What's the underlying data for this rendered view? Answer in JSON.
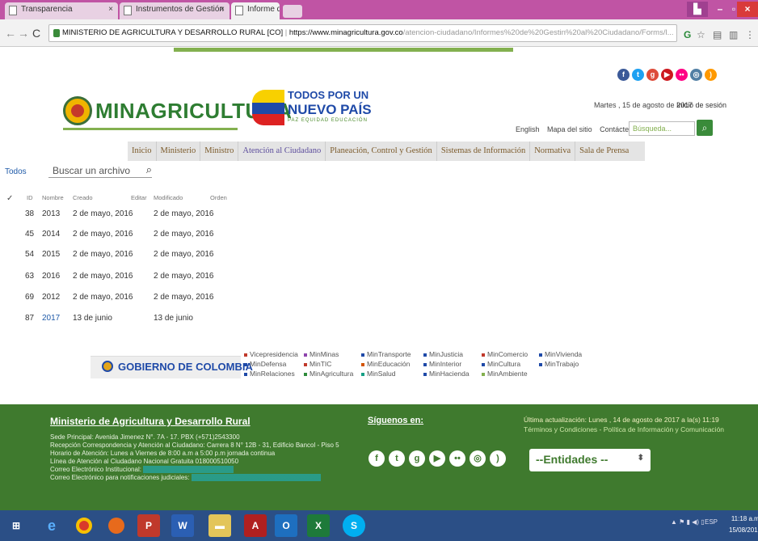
{
  "browser": {
    "tabs": [
      {
        "title": "Transparencia",
        "active": false
      },
      {
        "title": "Instrumentos de Gestión",
        "active": false
      },
      {
        "title": "Informe de Atención - T",
        "active": true
      }
    ],
    "url_site": "MINISTERIO DE AGRICULTURA Y DESARROLLO RURAL [CO]",
    "url_host": "https://www.minagricultura.gov.co",
    "url_path": "/atencion-ciudadano/Informes%20de%20Gestin%20al%20Ciudadano/Forms/l..."
  },
  "header": {
    "logo_text": "MINAGRICULTURA",
    "tpun_line1": "TODOS POR UN",
    "tpun_line2": "NUEVO PAÍS",
    "tpun_line3": "PAZ  EQUIDAD  EDUCACIÓN",
    "date": "Martes , 15 de agosto de 2017",
    "login": "Inicio de sesión",
    "links": [
      "English",
      "Mapa del sitio",
      "Contáctenos"
    ],
    "search_placeholder": "Búsqueda..."
  },
  "nav": [
    "Inicio",
    "Ministerio",
    "Ministro",
    "Atención al Ciudadano",
    "Planeación, Control y Gestión",
    "Sistemas de Información",
    "Normativa",
    "Sala de Prensa"
  ],
  "doclib": {
    "view_label": "Todos",
    "search_placeholder": "Buscar un archivo",
    "columns": [
      "ID",
      "Nombre",
      "Creado",
      "Editar",
      "Modificado",
      "Orden"
    ],
    "rows": [
      {
        "id": "38",
        "name": "2013",
        "created": "2 de mayo, 2016",
        "modified": "2 de mayo, 2016"
      },
      {
        "id": "45",
        "name": "2014",
        "created": "2 de mayo, 2016",
        "modified": "2 de mayo, 2016"
      },
      {
        "id": "54",
        "name": "2015",
        "created": "2 de mayo, 2016",
        "modified": "2 de mayo, 2016"
      },
      {
        "id": "63",
        "name": "2016",
        "created": "2 de mayo, 2016",
        "modified": "2 de mayo, 2016"
      },
      {
        "id": "69",
        "name": "2012",
        "created": "2 de mayo, 2016",
        "modified": "2 de mayo, 2016"
      },
      {
        "id": "87",
        "name": "2017",
        "created": "13 de junio",
        "modified": "13 de junio"
      }
    ]
  },
  "gobierno": {
    "label": "GOBIERNO DE COLOMBIA",
    "columns": [
      [
        "Vicepresidencia",
        "MinDefensa",
        "MinRelaciones"
      ],
      [
        "MinMinas",
        "MinTIC",
        "MinAgricultura"
      ],
      [
        "MinTransporte",
        "MinEducación",
        "MinSalud"
      ],
      [
        "MinJusticia",
        "MinInterior",
        "MinHacienda"
      ],
      [
        "MinComercio",
        "MinCultura",
        "MinAmbiente"
      ],
      [
        "MinVivienda",
        "MinTrabajo"
      ]
    ],
    "bullet_colors": [
      "#c0392b",
      "#1f4aa8",
      "#2e8b3a",
      "#8e44ad",
      "#d35400",
      "#16a085"
    ]
  },
  "footer": {
    "title": "Ministerio de Agricultura y Desarrollo Rural",
    "lines": [
      "Sede Principal: Avenida Jimenez N°. 7A - 17. PBX (+571)2543300",
      "Recepción Correspondencia y Atención al Ciudadano: Carrera 8 N° 12B - 31, Edificio Bancol - Piso 5",
      "Horario de Atención: Lunes a Viernes de 8:00 a.m a 5:00 p.m jornada continua",
      "Línea de Atención al Ciudadano Nacional Gratuita 018000510050"
    ],
    "email_inst_label": "Correo Electrónico Institucional:",
    "email_notif_label": "Correo Electrónico para notificaciones judiciales:",
    "follow": "Síguenos en:",
    "updated": "Última actualización: Lunes , 14 de agosto de 2017 a la(s) 11:19",
    "terms": "Términos y Condiciones - Política de Información y Comunicación",
    "entidades": "--Entidades --"
  },
  "taskbar": {
    "lang": "ESP",
    "time": "11:18 a.m.",
    "date": "15/08/2017"
  }
}
